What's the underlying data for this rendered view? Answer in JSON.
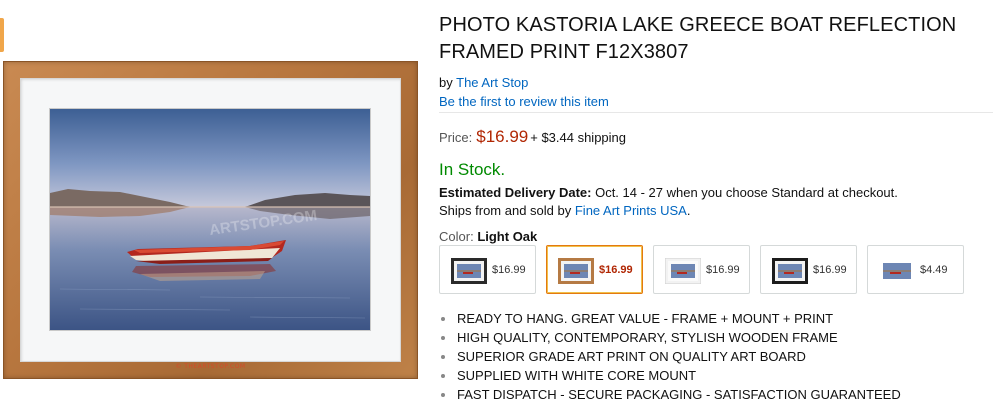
{
  "product": {
    "title": "PHOTO KASTORIA LAKE GREECE BOAT REFLECTION FRAMED PRINT F12X3807",
    "by_prefix": "by",
    "brand": "The Art Stop",
    "review_link": "Be the first to review this item"
  },
  "image": {
    "watermark": "ARTSTOP.COM",
    "stamp": "© THEARTSTOP.COM"
  },
  "pricing": {
    "label": "Price:",
    "price": "$16.99",
    "shipping": "+ $3.44 shipping"
  },
  "availability": {
    "stock": "In Stock.",
    "delivery_label": "Estimated Delivery Date:",
    "delivery_text": "Oct. 14 - 27 when you choose Standard at checkout.",
    "ships_prefix": "Ships from and sold by",
    "seller": "Fine Art Prints USA",
    "ships_suffix": "."
  },
  "color": {
    "label": "Color:",
    "selected": "Light Oak",
    "options": [
      {
        "price": "$16.99",
        "frame_color": "#2a2a2a",
        "selected": false
      },
      {
        "price": "$16.99",
        "frame_color": "#b57a44",
        "selected": true
      },
      {
        "price": "$16.99",
        "frame_color": "#f2f2f2",
        "selected": false
      },
      {
        "price": "$16.99",
        "frame_color": "#1c1c1c",
        "selected": false
      },
      {
        "price": "$4.49",
        "frame_color": "none",
        "selected": false
      }
    ]
  },
  "features": [
    "READY TO HANG. GREAT VALUE - FRAME + MOUNT + PRINT",
    "HIGH QUALITY, CONTEMPORARY, STYLISH WOODEN FRAME",
    "SUPERIOR GRADE ART PRINT ON QUALITY ART BOARD",
    "SUPPLIED WITH WHITE CORE MOUNT",
    "FAST DISPATCH - SECURE PACKAGING - SATISFACTION GUARANTEED"
  ]
}
